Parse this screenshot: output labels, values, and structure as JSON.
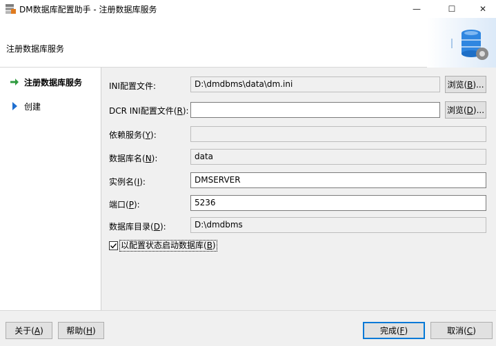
{
  "window": {
    "title": "DM数据库配置助手 - 注册数据库服务",
    "minimize_glyph": "—",
    "maximize_glyph": "☐",
    "close_glyph": "✕"
  },
  "header": {
    "title": "注册数据库服务",
    "art_icon": "database-gear-icon"
  },
  "nav": {
    "items": [
      {
        "label": "注册数据库服务",
        "icon": "arrow-right-icon",
        "active": true
      },
      {
        "label": "创建",
        "icon": "triangle-right-icon",
        "active": false
      }
    ]
  },
  "form": {
    "ini_file": {
      "label": "INI配置文件:",
      "value": "D:\\dmdbms\\data\\dm.ini"
    },
    "dcr_ini_file": {
      "label_pre": "DCR INI配置文件(",
      "label_key": "R",
      "label_post": "):",
      "value": ""
    },
    "depend_service": {
      "label_pre": "依赖服务(",
      "label_key": "Y",
      "label_post": "):",
      "value": ""
    },
    "db_name": {
      "label_pre": "数据库名(",
      "label_key": "N",
      "label_post": "):",
      "value": "data"
    },
    "instance_name": {
      "label_pre": "实例名(",
      "label_key": "I",
      "label_post": "):",
      "value": "DMSERVER"
    },
    "port": {
      "label_pre": "端口(",
      "label_key": "P",
      "label_post": "):",
      "value": "5236"
    },
    "db_dir": {
      "label_pre": "数据库目录(",
      "label_key": "D",
      "label_post": "):",
      "value": "D:\\dmdbms"
    },
    "browse_b": {
      "pre": "浏览(",
      "key": "B",
      "post": ")..."
    },
    "browse_d": {
      "pre": "浏览(",
      "key": "D",
      "post": ")..."
    },
    "start_with_config": {
      "checked": true,
      "pre": "以配置状态启动数据库(",
      "key": "B",
      "post": ")"
    }
  },
  "footer": {
    "about": {
      "pre": "关于(",
      "key": "A",
      "post": ")"
    },
    "help": {
      "pre": "帮助(",
      "key": "H",
      "post": ")"
    },
    "finish": {
      "pre": "完成(",
      "key": "F",
      "post": ")"
    },
    "cancel": {
      "pre": "取消(",
      "key": "C",
      "post": ")"
    }
  },
  "colors": {
    "accent": "#0078d7",
    "nav_arrow": "#2e9a3e",
    "nav_triangle": "#1f6fd0"
  }
}
